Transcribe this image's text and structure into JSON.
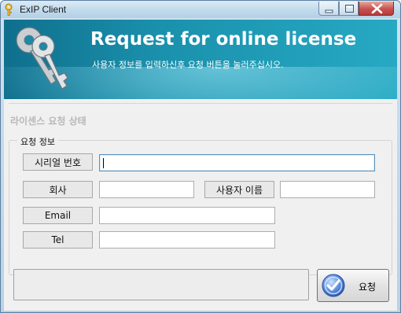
{
  "window": {
    "title": "ExIP Client",
    "controls": {
      "minimize": "minimize-icon",
      "maximize": "maximize-icon",
      "close": "close-icon"
    }
  },
  "banner": {
    "title": "Request for online license",
    "subtitle": "사용자 정보를 입력하신후 요청 버튼을 눌러주십시오."
  },
  "status": {
    "title": "라이센스 요청 상태"
  },
  "form": {
    "group_label": "요청 정보",
    "serial_label": "시리얼 번호",
    "serial_value": "",
    "company_label": "회사",
    "company_value": "",
    "username_label": "사용자 이름",
    "username_value": "",
    "email_label": "Email",
    "email_value": "",
    "tel_label": "Tel",
    "tel_value": ""
  },
  "footer": {
    "status_text": "",
    "request_button": "요청"
  },
  "colors": {
    "banner_dark": "#0f6f8d",
    "banner_light": "#27a9c3",
    "close_red": "#c75050"
  }
}
